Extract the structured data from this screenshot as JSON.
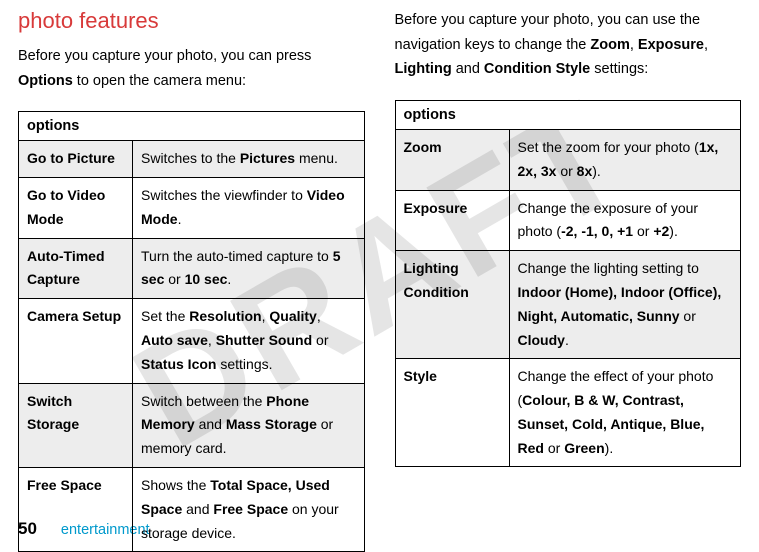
{
  "watermark": "DRAFT",
  "left": {
    "title": "photo features",
    "intro_pre": "Before you capture your photo, you can press ",
    "intro_bold": "Options",
    "intro_post": " to open the camera menu:",
    "header": "options",
    "rows": [
      {
        "label": "Go to Picture",
        "pre": "Switches to the ",
        "b1": "Pictures",
        "mid": " menu."
      },
      {
        "label": "Go to Video Mode",
        "pre": "Switches the viewfinder to ",
        "b1": "Video Mode",
        "mid": "."
      },
      {
        "label": "Auto-Timed Capture",
        "pre": "Turn the auto-timed capture to ",
        "b1": "5 sec",
        "mid": " or ",
        "b2": "10 sec",
        "post": "."
      },
      {
        "label": "Camera Setup",
        "pre": "Set the ",
        "b1": "Resolution",
        "mid": ", ",
        "b2": "Quality",
        "mid2": ", ",
        "b3": "Auto save",
        "mid3": ", ",
        "b4": "Shutter Sound",
        "mid4": " or ",
        "b5": "Status Icon",
        "post": " settings."
      },
      {
        "label": "Switch Storage",
        "pre": "Switch between the ",
        "b1": "Phone Memory",
        "mid": " and ",
        "b2": "Mass Storage",
        "post": " or memory card."
      },
      {
        "label": "Free Space",
        "pre": "Shows the ",
        "b1": "Total Space, Used Space",
        "mid": " and ",
        "b2": "Free Space",
        "post": " on your storage device."
      }
    ]
  },
  "right": {
    "intro_pre": "Before you capture your photo, you can use the navigation keys to change the ",
    "b1": "Zoom",
    "s1": ", ",
    "b2": "Exposure",
    "s2": ", ",
    "b3": "Lighting",
    "s3": " and ",
    "b4": "Condition Style",
    "intro_post": " settings:",
    "header": "options",
    "rows": [
      {
        "label": "Zoom",
        "pre": "Set the zoom for your photo (",
        "b1": "1x, 2x, 3x",
        "mid": " or ",
        "b2": "8x",
        "post": ")."
      },
      {
        "label": "Exposure",
        "pre": "Change the exposure of your photo (",
        "b1": "-2, -1, 0, +1",
        "mid": " or ",
        "b2": "+2",
        "post": ")."
      },
      {
        "label": "Lighting Condition",
        "pre": "Change the lighting setting to ",
        "b1": "Indoor (Home), Indoor (Office), Night, Automatic, Sunny",
        "mid": " or ",
        "b2": "Cloudy",
        "post": "."
      },
      {
        "label": "Style",
        "pre": "Change the effect of your photo (",
        "b1": "Colour, B & W, Contrast, Sunset, Cold, Antique, Blue, Red",
        "mid": " or ",
        "b2": "Green",
        "post": ")."
      }
    ]
  },
  "footer": {
    "page": "50",
    "label": "entertainment"
  }
}
